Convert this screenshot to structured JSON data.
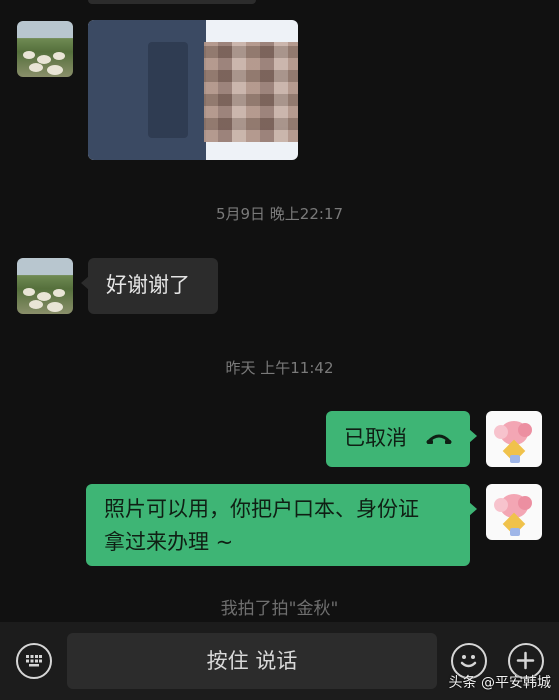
{
  "chat": {
    "timestamps": [
      "5月9日 晚上22:17",
      "昨天 上午11:42"
    ],
    "messages": {
      "incoming_text": "好谢谢了",
      "outgoing_call": "已取消",
      "outgoing_text_line1": "照片可以用，你把户口本、身份证",
      "outgoing_text_line2": "拿过来办理 ~"
    },
    "system_note": "我拍了拍\"金秋\""
  },
  "input_bar": {
    "hold_to_talk": "按住 说话",
    "icons": [
      "keyboard-icon",
      "emoji-icon",
      "plus-icon"
    ]
  },
  "watermark": {
    "prefix": "头条",
    "handle": "@平安韩城"
  },
  "colors": {
    "background": "#111111",
    "incoming_bubble": "#2c2c2c",
    "outgoing_bubble": "#3eb575",
    "bottom_bar": "#1c1c1c"
  }
}
